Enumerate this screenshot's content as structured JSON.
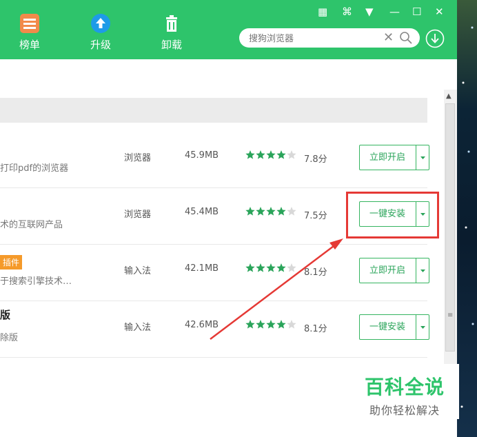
{
  "nav": {
    "rank": "榜单",
    "upgrade": "升级",
    "uninstall": "卸载"
  },
  "search": {
    "placeholder": "搜狗浏览器"
  },
  "rows": [
    {
      "desc": "打印pdf的浏览器",
      "category": "浏览器",
      "size": "45.9MB",
      "rating": 4,
      "score": "7.8分",
      "action": "立即开启"
    },
    {
      "desc": "术的互联网产品",
      "category": "浏览器",
      "size": "45.4MB",
      "rating": 4,
      "score": "7.5分",
      "action": "一键安装"
    },
    {
      "badge": "插件",
      "desc": "于搜索引擎技术…",
      "category": "输入法",
      "size": "42.1MB",
      "rating": 4,
      "score": "8.1分",
      "action": "立即开启"
    },
    {
      "title": "版",
      "desc": "除版",
      "category": "输入法",
      "size": "42.6MB",
      "rating": 4,
      "score": "8.1分",
      "action": "一键安装"
    }
  ],
  "watermark": {
    "line1": "百科全说",
    "line2": "助你轻松解决"
  },
  "colors": {
    "header": "#2ec46b",
    "accent_green": "#34b45f",
    "highlight": "#e53935",
    "star": "#2aa45a"
  }
}
